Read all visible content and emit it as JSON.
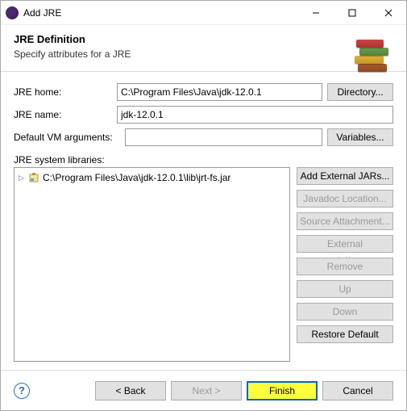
{
  "window": {
    "title": "Add JRE"
  },
  "header": {
    "title": "JRE Definition",
    "subtitle": "Specify attributes for a JRE"
  },
  "fields": {
    "jre_home_label": "JRE home:",
    "jre_home_value": "C:\\Program Files\\Java\\jdk-12.0.1",
    "directory_btn": "Directory...",
    "jre_name_label": "JRE name:",
    "jre_name_value": "jdk-12.0.1",
    "vm_args_label": "Default VM arguments:",
    "vm_args_value": "",
    "variables_btn": "Variables...",
    "libs_label": "JRE system libraries:"
  },
  "tree": {
    "items": [
      {
        "label": "C:\\Program Files\\Java\\jdk-12.0.1\\lib\\jrt-fs.jar"
      }
    ]
  },
  "side_buttons": {
    "add_external": "Add External JARs...",
    "javadoc": "Javadoc Location...",
    "source": "Source Attachment...",
    "ext_anno": "External annotations...",
    "remove": "Remove",
    "up": "Up",
    "down": "Down",
    "restore": "Restore Default"
  },
  "footer": {
    "back": "< Back",
    "next": "Next >",
    "finish": "Finish",
    "cancel": "Cancel"
  }
}
